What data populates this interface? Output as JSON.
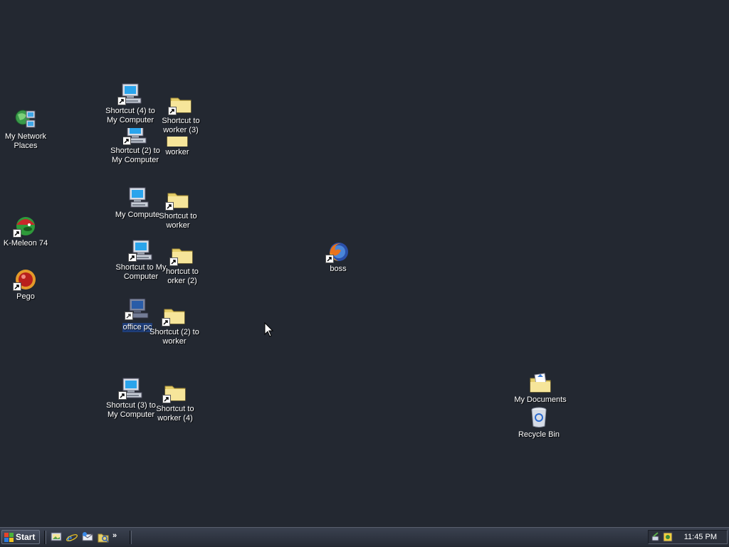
{
  "desktop": {
    "icons": {
      "network": "My Network\nPlaces",
      "kmeleon": "K-Meleon 74",
      "pego": "Pego",
      "sc4_mycomputer": "Shortcut (4) to\nMy Computer",
      "sc_worker3": "Shortcut to\nworker (3)",
      "sc2_mycomputer": "Shortcut (2) to\nMy Computer",
      "worker": "worker",
      "mycomputer": "My Compute",
      "sc_worker": "Shortcut to\nworker",
      "sc_mycomputer": "Shortcut to My\nComputer",
      "sc_worker2": "hortcut to\norker (2)",
      "office_pc": "office pc",
      "sc2_worker": "Shortcut (2) to\nworker",
      "sc3_mycomputer": "Shortcut (3) to\nMy Computer",
      "sc_worker4": "Shortcut to\nworker (4)",
      "boss": "boss",
      "my_documents": "My Documents",
      "recycle_bin": "Recycle Bin"
    },
    "background_color": "#232831"
  },
  "taskbar": {
    "start_label": "Start",
    "clock": "11:45 PM",
    "quick_launch": [
      "desktop-icon",
      "internet-explorer-icon",
      "outlook-express-icon",
      "windows-explorer-icon"
    ]
  }
}
